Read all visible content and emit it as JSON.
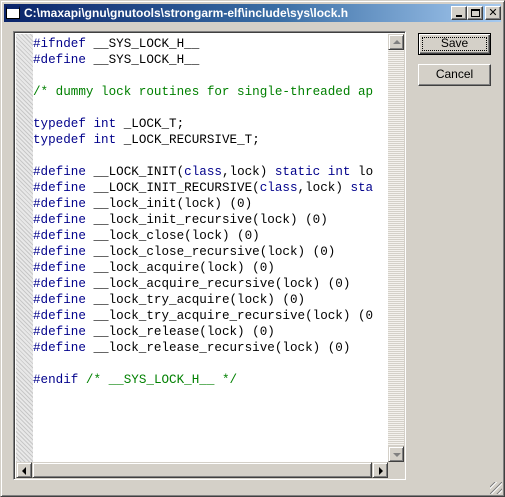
{
  "window": {
    "title": "C:\\maxapi\\gnu\\gnutools\\strongarm-elf\\include\\sys\\lock.h"
  },
  "buttons": {
    "save_label": "Save",
    "cancel_label": "Cancel"
  },
  "colors": {
    "keyword": "#00008b",
    "comment": "#008000",
    "text": "#000000"
  },
  "code": {
    "lines": [
      [
        {
          "k": "kw",
          "t": "#ifndef"
        },
        {
          "k": "tx",
          "t": " __SYS_LOCK_H__"
        }
      ],
      [
        {
          "k": "kw",
          "t": "#define"
        },
        {
          "k": "tx",
          "t": " __SYS_LOCK_H__"
        }
      ],
      [],
      [
        {
          "k": "cm",
          "t": "/* dummy lock routines for single-threaded ap"
        }
      ],
      [],
      [
        {
          "k": "kw",
          "t": "typedef"
        },
        {
          "k": "tx",
          "t": " "
        },
        {
          "k": "kw",
          "t": "int"
        },
        {
          "k": "tx",
          "t": " _LOCK_T;"
        }
      ],
      [
        {
          "k": "kw",
          "t": "typedef"
        },
        {
          "k": "tx",
          "t": " "
        },
        {
          "k": "kw",
          "t": "int"
        },
        {
          "k": "tx",
          "t": " _LOCK_RECURSIVE_T;"
        }
      ],
      [],
      [
        {
          "k": "kw",
          "t": "#define"
        },
        {
          "k": "tx",
          "t": " __LOCK_INIT("
        },
        {
          "k": "kw",
          "t": "class"
        },
        {
          "k": "tx",
          "t": ",lock) "
        },
        {
          "k": "kw",
          "t": "static"
        },
        {
          "k": "tx",
          "t": " "
        },
        {
          "k": "kw",
          "t": "int"
        },
        {
          "k": "tx",
          "t": " lo"
        }
      ],
      [
        {
          "k": "kw",
          "t": "#define"
        },
        {
          "k": "tx",
          "t": " __LOCK_INIT_RECURSIVE("
        },
        {
          "k": "kw",
          "t": "class"
        },
        {
          "k": "tx",
          "t": ",lock) "
        },
        {
          "k": "kw",
          "t": "sta"
        }
      ],
      [
        {
          "k": "kw",
          "t": "#define"
        },
        {
          "k": "tx",
          "t": " __lock_init(lock) (0)"
        }
      ],
      [
        {
          "k": "kw",
          "t": "#define"
        },
        {
          "k": "tx",
          "t": " __lock_init_recursive(lock) (0)"
        }
      ],
      [
        {
          "k": "kw",
          "t": "#define"
        },
        {
          "k": "tx",
          "t": " __lock_close(lock) (0)"
        }
      ],
      [
        {
          "k": "kw",
          "t": "#define"
        },
        {
          "k": "tx",
          "t": " __lock_close_recursive(lock) (0)"
        }
      ],
      [
        {
          "k": "kw",
          "t": "#define"
        },
        {
          "k": "tx",
          "t": " __lock_acquire(lock) (0)"
        }
      ],
      [
        {
          "k": "kw",
          "t": "#define"
        },
        {
          "k": "tx",
          "t": " __lock_acquire_recursive(lock) (0)"
        }
      ],
      [
        {
          "k": "kw",
          "t": "#define"
        },
        {
          "k": "tx",
          "t": " __lock_try_acquire(lock) (0)"
        }
      ],
      [
        {
          "k": "kw",
          "t": "#define"
        },
        {
          "k": "tx",
          "t": " __lock_try_acquire_recursive(lock) (0"
        }
      ],
      [
        {
          "k": "kw",
          "t": "#define"
        },
        {
          "k": "tx",
          "t": " __lock_release(lock) (0)"
        }
      ],
      [
        {
          "k": "kw",
          "t": "#define"
        },
        {
          "k": "tx",
          "t": " __lock_release_recursive(lock) (0)"
        }
      ],
      [],
      [
        {
          "k": "kw",
          "t": "#endif"
        },
        {
          "k": "tx",
          "t": " "
        },
        {
          "k": "cm",
          "t": "/* __SYS_LOCK_H__ */"
        }
      ]
    ]
  }
}
